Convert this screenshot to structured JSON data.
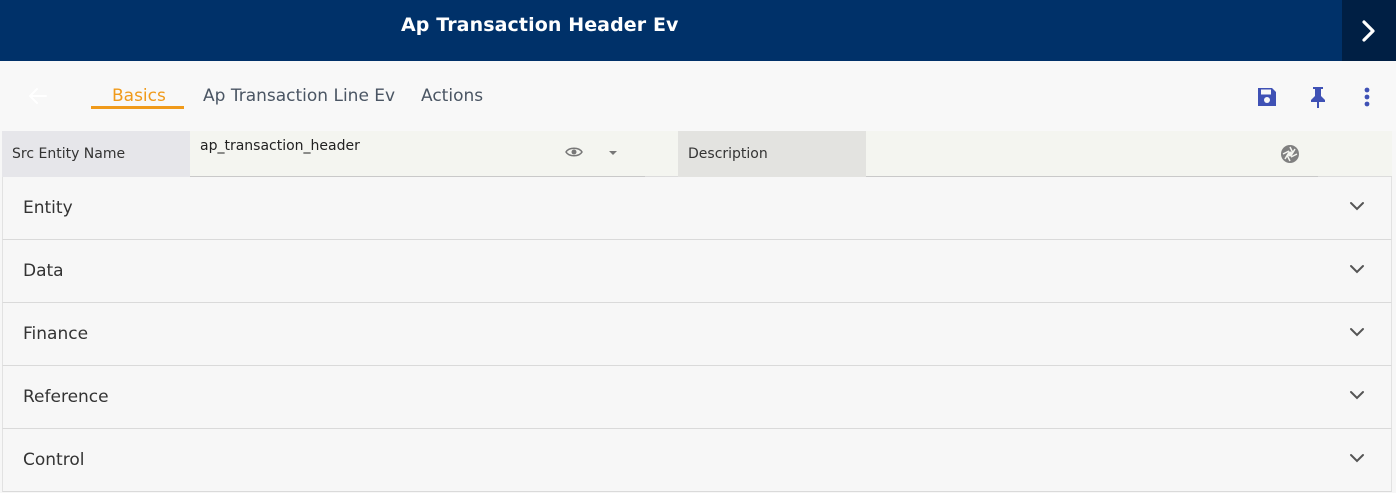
{
  "header": {
    "title": "Ap Transaction Header Ev",
    "expand_icon": "chevron-right-icon"
  },
  "toolbar": {
    "back_icon": "arrow-left-icon",
    "tabs": [
      {
        "label": "Basics",
        "active": true
      },
      {
        "label": "Ap Transaction Line Ev",
        "active": false
      },
      {
        "label": "Actions",
        "active": false
      }
    ],
    "actions": [
      {
        "icon": "save-icon"
      },
      {
        "icon": "pin-icon"
      },
      {
        "icon": "more-vertical-icon"
      }
    ],
    "accent_color": "#f09a1a",
    "icon_color": "#3f51b5"
  },
  "fields": {
    "src_entity_name": {
      "label": "Src Entity Name",
      "value": "ap_transaction_header"
    },
    "description": {
      "label": "Description",
      "value": ""
    }
  },
  "sections": [
    {
      "label": "Entity"
    },
    {
      "label": "Data"
    },
    {
      "label": "Finance"
    },
    {
      "label": "Reference"
    },
    {
      "label": "Control"
    }
  ],
  "colors": {
    "header_bg": "#003169",
    "header_expand_bg": "#001f44"
  }
}
